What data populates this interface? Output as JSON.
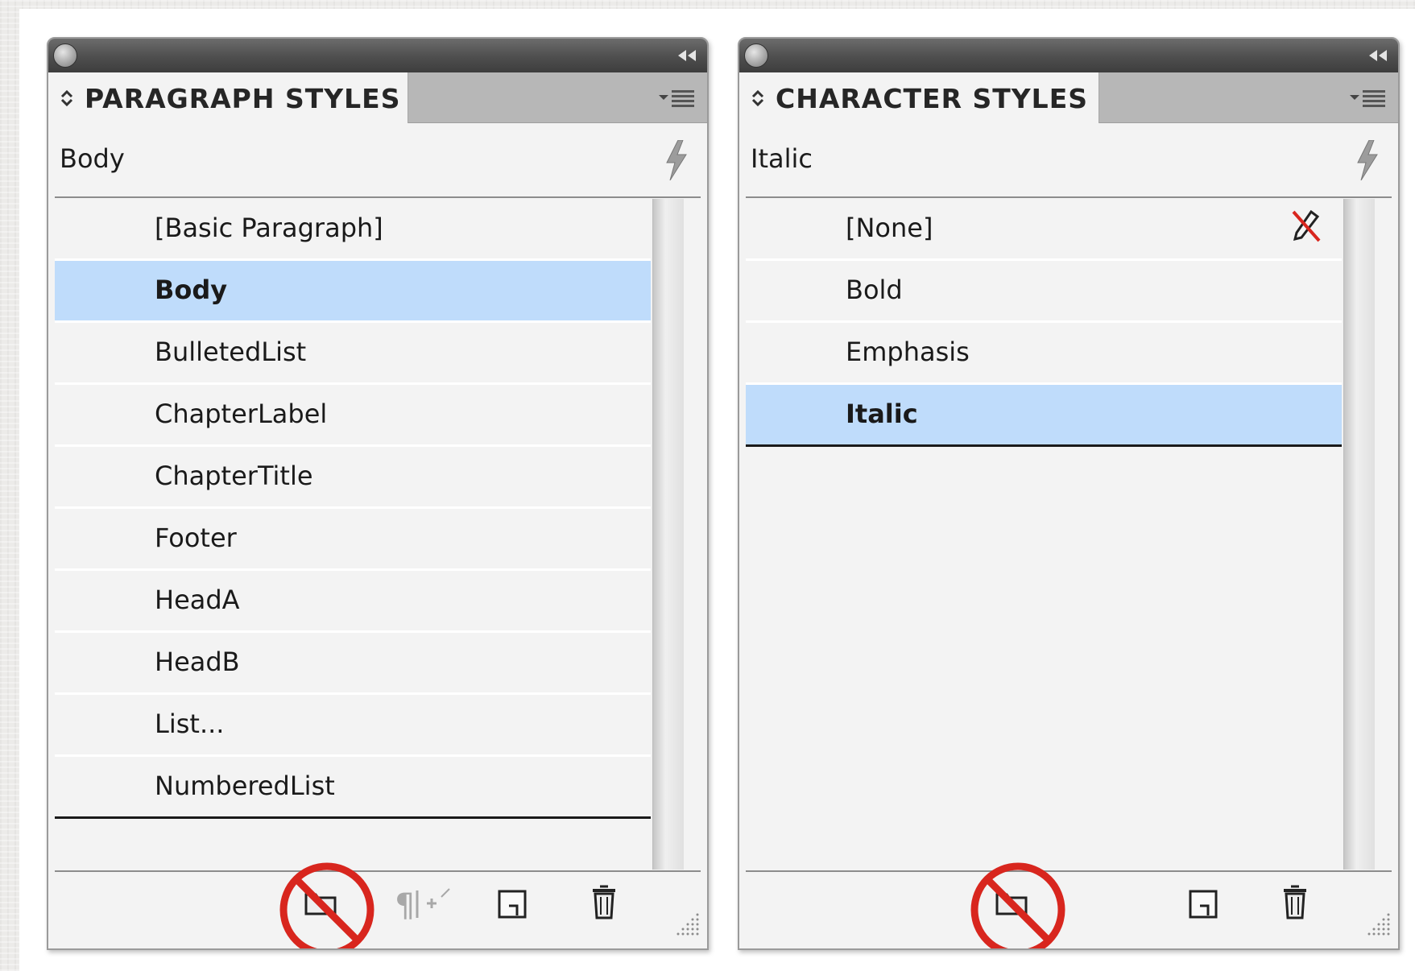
{
  "paragraph_panel": {
    "title": "PARAGRAPH STYLES",
    "current_style": "Body",
    "styles": [
      "[Basic Paragraph]",
      "Body",
      "BulletedList",
      "ChapterLabel",
      "ChapterTitle",
      "Footer",
      "HeadA",
      "HeadB",
      "List...",
      "NumberedList"
    ],
    "selected": "Body"
  },
  "character_panel": {
    "title": "CHARACTER STYLES",
    "current_style": "Italic",
    "styles": [
      "[None]",
      "Bold",
      "Emphasis",
      "Italic"
    ],
    "selected": "Italic"
  },
  "colors": {
    "selection": "#bfdcfb",
    "no_sign": "#d8261e"
  },
  "icons": [
    "close-icon",
    "collapse-arrows-icon",
    "panel-menu-icon",
    "quick-apply-lightning-icon",
    "new-style-group-folder-icon",
    "clear-overrides-icon",
    "new-style-icon",
    "delete-trash-icon",
    "prohibited-icon",
    "resize-grip-icon",
    "no-style-pencil-icon"
  ]
}
